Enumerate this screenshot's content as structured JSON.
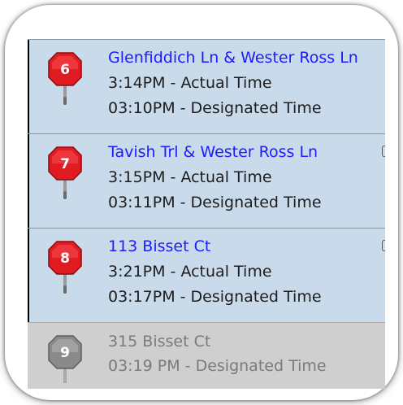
{
  "colors": {
    "active_row": "#c9daea",
    "inactive_row": "#cfcfcf",
    "street_link": "#1c1cff",
    "pin_active": "#e01b22",
    "pin_inactive": "#8a8a8a"
  },
  "stops": [
    {
      "number": "6",
      "street": "Glenfiddich Ln & Wester Ross Ln",
      "actual": "3:14PM - Actual Time",
      "designated": "03:10PM - Designated Time",
      "status": "active",
      "icon": "stop-sign-pin-icon"
    },
    {
      "number": "7",
      "street": "Tavish Trl & Wester Ross Ln",
      "actual": "3:15PM - Actual Time",
      "designated": "03:11PM - Designated Time",
      "status": "active",
      "icon": "stop-sign-pin-icon"
    },
    {
      "number": "8",
      "street": "113 Bisset Ct",
      "actual": "3:21PM - Actual Time",
      "designated": "03:17PM - Designated Time",
      "status": "active",
      "icon": "stop-sign-pin-icon"
    },
    {
      "number": "9",
      "street": "315 Bisset Ct",
      "designated": "03:19 PM - Designated Time",
      "status": "inactive",
      "icon": "stop-sign-pin-icon"
    }
  ]
}
